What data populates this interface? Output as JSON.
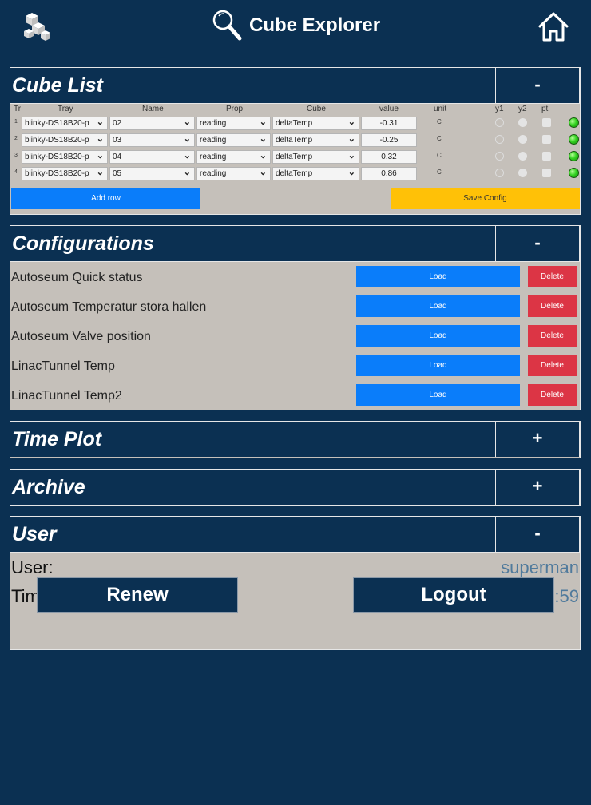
{
  "header": {
    "title": "Cube Explorer",
    "logo_icon": "cube-logo-icon",
    "search_icon": "search-icon",
    "home_icon": "home-icon"
  },
  "cube_list": {
    "title": "Cube List",
    "toggle": "-",
    "columns": [
      "Tr",
      "Tray",
      "Name",
      "Prop",
      "Cube",
      "value",
      "unit",
      "y1",
      "y2",
      "pt"
    ],
    "rows": [
      {
        "index": "1",
        "tray": "blinky-DS18B20-p",
        "name": "02",
        "prop": "reading",
        "cube": "deltaTemp",
        "value": "-0.31",
        "unit": "C"
      },
      {
        "index": "2",
        "tray": "blinky-DS18B20-p",
        "name": "03",
        "prop": "reading",
        "cube": "deltaTemp",
        "value": "-0.25",
        "unit": "C"
      },
      {
        "index": "3",
        "tray": "blinky-DS18B20-p",
        "name": "04",
        "prop": "reading",
        "cube": "deltaTemp",
        "value": "0.32",
        "unit": "C"
      },
      {
        "index": "4",
        "tray": "blinky-DS18B20-p",
        "name": "05",
        "prop": "reading",
        "cube": "deltaTemp",
        "value": "0.86",
        "unit": "C"
      }
    ],
    "add_row_label": "Add row",
    "save_config_label": "Save Config",
    "status_color": "#35d322"
  },
  "configurations": {
    "title": "Configurations",
    "toggle": "-",
    "items": [
      {
        "name": "Autoseum Quick status",
        "load": "Load",
        "delete": "Delete"
      },
      {
        "name": "Autoseum Temperatur stora hallen",
        "load": "Load",
        "delete": "Delete"
      },
      {
        "name": "Autoseum Valve position",
        "load": "Load",
        "delete": "Delete"
      },
      {
        "name": "LinacTunnel Temp",
        "load": "Load",
        "delete": "Delete"
      },
      {
        "name": "LinacTunnel Temp2",
        "load": "Load",
        "delete": "Delete"
      }
    ]
  },
  "time_plot": {
    "title": "Time Plot",
    "toggle": "+"
  },
  "archive": {
    "title": "Archive",
    "toggle": "+"
  },
  "user": {
    "title": "User",
    "toggle": "-",
    "user_label": "User:",
    "user_value": "superman",
    "time_label": "Time left:",
    "time_value": "07:32:59",
    "renew_label": "Renew",
    "logout_label": "Logout"
  },
  "colors": {
    "background": "#0b3052",
    "panel": "#c5c0ba",
    "primary": "#0a7dfa",
    "warning": "#ffc107",
    "danger": "#dc3545"
  }
}
